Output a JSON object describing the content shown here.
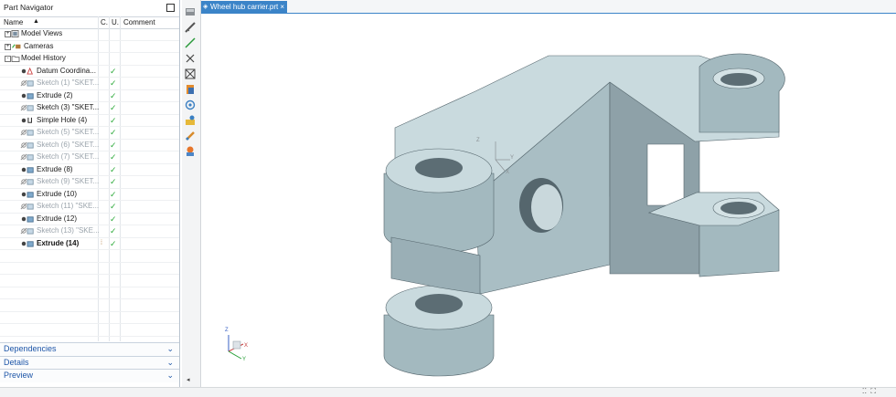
{
  "navigator": {
    "title": "Part Navigator",
    "columns": {
      "name": "Name",
      "c": "C.",
      "u": "U.",
      "comment": "Comment"
    },
    "rows": [
      {
        "label": "Model Views",
        "indent": 0,
        "expander": "+",
        "icon": "model-views-icon",
        "check": "",
        "style": "normal"
      },
      {
        "label": "Cameras",
        "indent": 0,
        "expander": "+",
        "icon": "cameras-icon",
        "check": "",
        "style": "normal"
      },
      {
        "label": "Model History",
        "indent": 0,
        "expander": "-",
        "icon": "folder-icon",
        "check": "",
        "style": "normal"
      },
      {
        "label": "Datum Coordina...",
        "indent": 1,
        "expander": "",
        "icon": "datum-csys-icon",
        "check": "✓",
        "style": "normal"
      },
      {
        "label": "Sketch (1) \"SKET...",
        "indent": 1,
        "expander": "",
        "icon": "sketch-icon",
        "check": "✓",
        "style": "dim"
      },
      {
        "label": "Extrude (2)",
        "indent": 1,
        "expander": "",
        "icon": "extrude-icon",
        "check": "✓",
        "style": "normal"
      },
      {
        "label": "Sketch (3) \"SKET...",
        "indent": 1,
        "expander": "",
        "icon": "sketch-icon",
        "check": "✓",
        "style": "normal"
      },
      {
        "label": "Simple Hole (4)",
        "indent": 1,
        "expander": "",
        "icon": "hole-icon",
        "check": "✓",
        "style": "normal"
      },
      {
        "label": "Sketch (5) \"SKET...",
        "indent": 1,
        "expander": "",
        "icon": "sketch-icon",
        "check": "✓",
        "style": "dim"
      },
      {
        "label": "Sketch (6) \"SKET...",
        "indent": 1,
        "expander": "",
        "icon": "sketch-icon",
        "check": "✓",
        "style": "dim"
      },
      {
        "label": "Sketch (7) \"SKET...",
        "indent": 1,
        "expander": "",
        "icon": "sketch-icon",
        "check": "✓",
        "style": "dim"
      },
      {
        "label": "Extrude (8)",
        "indent": 1,
        "expander": "",
        "icon": "extrude-icon",
        "check": "✓",
        "style": "normal"
      },
      {
        "label": "Sketch (9) \"SKET...",
        "indent": 1,
        "expander": "",
        "icon": "sketch-icon",
        "check": "✓",
        "style": "dim"
      },
      {
        "label": "Extrude (10)",
        "indent": 1,
        "expander": "",
        "icon": "extrude-icon",
        "check": "✓",
        "style": "normal"
      },
      {
        "label": "Sketch (11) \"SKE...",
        "indent": 1,
        "expander": "",
        "icon": "sketch-icon",
        "check": "✓",
        "style": "dim"
      },
      {
        "label": "Extrude (12)",
        "indent": 1,
        "expander": "",
        "icon": "extrude-icon",
        "check": "✓",
        "style": "normal"
      },
      {
        "label": "Sketch (13) \"SKE...",
        "indent": 1,
        "expander": "",
        "icon": "sketch-icon",
        "check": "✓",
        "style": "dim"
      },
      {
        "label": "Extrude (14)",
        "indent": 1,
        "expander": "",
        "icon": "extrude-icon",
        "check": "✓",
        "style": "bold"
      }
    ],
    "footer": [
      {
        "label": "Dependencies"
      },
      {
        "label": "Details"
      },
      {
        "label": "Preview"
      }
    ]
  },
  "resource_bar": [
    "part-navigator-icon",
    "measure-icon",
    "line-icon",
    "close-icon",
    "box-x-icon",
    "material-icon",
    "reuse-library-icon",
    "roles-icon",
    "history-icon",
    "palette-icon"
  ],
  "tab": {
    "label": "Wheel hub carrier.prt",
    "close": "×"
  },
  "csys": {
    "x": "X",
    "y": "Y",
    "z": "Z"
  },
  "colors": {
    "accent": "#3b84c8",
    "model_face": "#a7bdc3",
    "model_top": "#c9dade",
    "check": "#2eaa3b"
  }
}
